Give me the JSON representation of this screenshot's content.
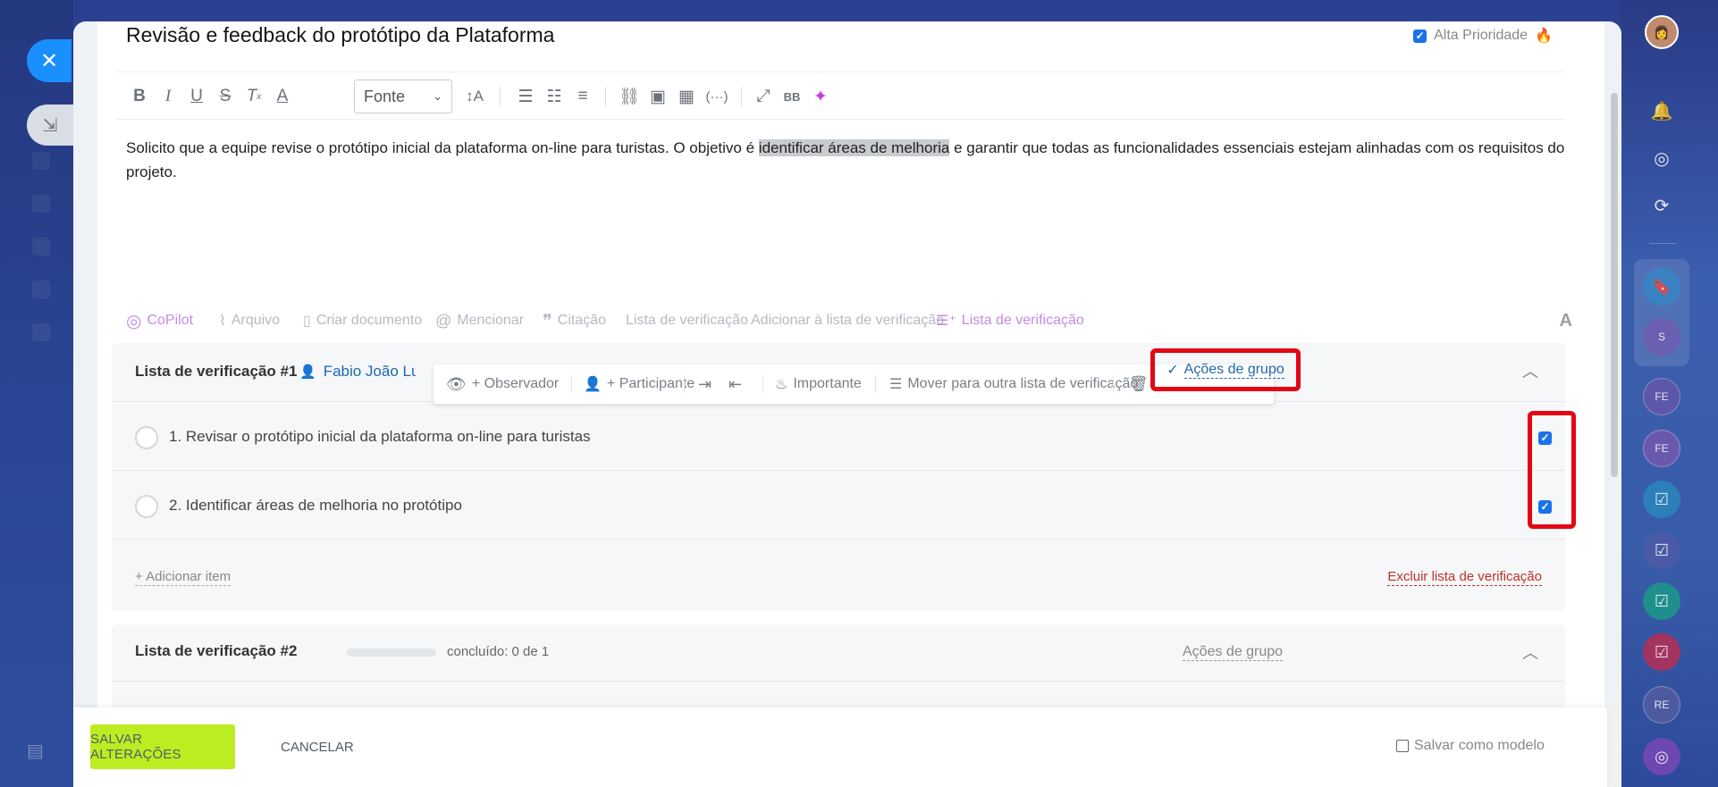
{
  "task": {
    "title": "Revisão e feedback do protótipo da Plataforma",
    "priority_label": "Alta Prioridade",
    "priority_checked": true,
    "description_before": "Solicito que a equipe revise o protótipo inicial da plataforma on-line para turistas. O objetivo é ",
    "description_highlight": "identificar áreas de melhoria",
    "description_after": " e garantir que todas as funcionalidades essenciais estejam alinhadas com os requisitos do projeto."
  },
  "toolbar": {
    "font_label": "Fonte",
    "icons": [
      "bold-icon",
      "italic-icon",
      "underline-icon",
      "strikethrough-icon",
      "clear-format-icon",
      "text-color-icon",
      "font-size-icon",
      "numbered-list-icon",
      "bullet-list-icon",
      "align-icon",
      "link-icon",
      "image-icon",
      "table-icon",
      "code-icon",
      "fullscreen-icon",
      "bbcode-icon",
      "ai-image-icon"
    ],
    "bbcode_label": "BB"
  },
  "editor_actions": {
    "copilot": "CoPilot",
    "arquivo": "Arquivo",
    "criar_documento": "Criar documento",
    "mencionar": "Mencionar",
    "citacao": "Citação",
    "lista_verificacao": "Lista de verificação",
    "adicionar_lista": "Adicionar à lista de verificação",
    "lista_verificacao_active": "Lista de verificação",
    "format_toggle": "A"
  },
  "checklist1": {
    "title": "Lista de verificação #1",
    "user": "Fabio João Luiz",
    "floating_toolbar": {
      "observer": "+ Observador",
      "participant": "+ Participante",
      "important": "Importante",
      "move": "Mover para outra lista de verificação"
    },
    "group_actions": "Ações de grupo",
    "items": [
      {
        "label": "1. Revisar o protótipo inicial da plataforma on-line para turistas",
        "selected": true
      },
      {
        "label": "2. Identificar áreas de melhoria no protótipo",
        "selected": true
      }
    ],
    "add_item": "+ Adicionar item",
    "delete_list": "Excluir lista de verificação"
  },
  "checklist2": {
    "title": "Lista de verificação #2",
    "progress_text": "concluído: 0 de 1",
    "progress_fraction": 0,
    "group_actions": "Ações de grupo"
  },
  "footer": {
    "save": "SALVAR ALTERAÇÕES",
    "cancel": "CANCELAR",
    "save_template": "Salvar como modelo"
  },
  "right_rail": {
    "items": [
      "S",
      "FE",
      "FE",
      "RE"
    ]
  },
  "colors": {
    "accent_blue": "#2067b0",
    "save_green": "#bbed21",
    "highlight_red": "#e30613",
    "danger": "#c0302b"
  }
}
